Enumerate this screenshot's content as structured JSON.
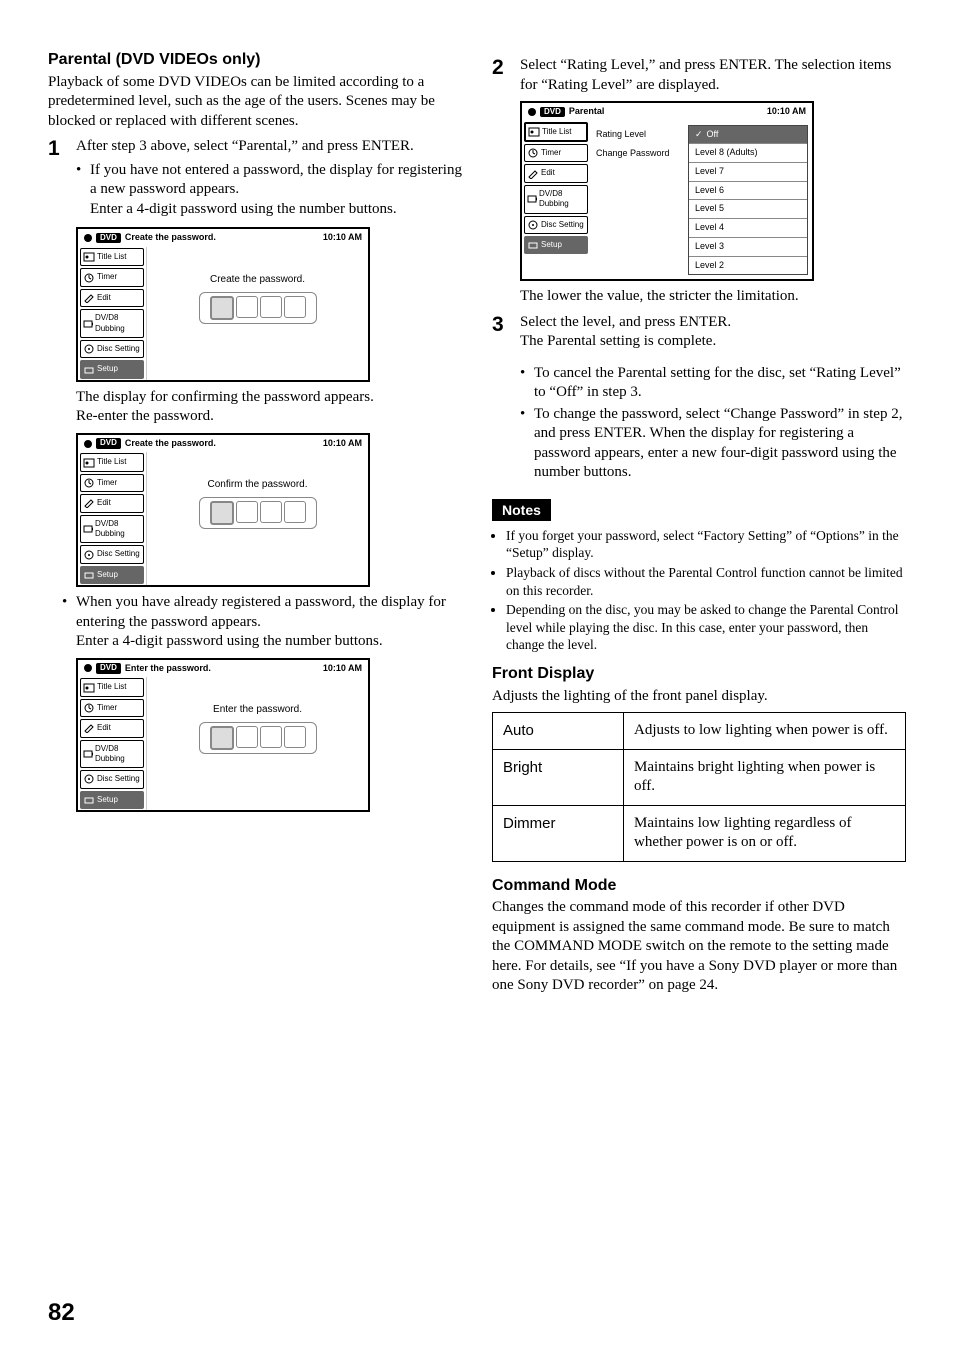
{
  "page_number": "82",
  "left": {
    "heading": "Parental (DVD VIDEOs only)",
    "intro": "Playback of some DVD VIDEOs can be limited according to a predetermined level, such as the age of the users. Scenes may be blocked or replaced with different scenes.",
    "step1": {
      "num": "1",
      "text": "After step 3 above, select “Parental,” and press ENTER.",
      "bullet": "If you have not entered a password, the display for registering a new password appears.",
      "bullet_cont": "Enter a 4-digit password using the number buttons."
    },
    "shot_common": {
      "dvd_badge": "DVD",
      "time": "10:10 AM",
      "menu": {
        "title_list": "Title List",
        "timer": "Timer",
        "edit": "Edit",
        "dv": "DV/D8 Dubbing",
        "disc_setting": "Disc Setting",
        "setup": "Setup"
      }
    },
    "shot1": {
      "title": "Create the password.",
      "prompt": "Create the password."
    },
    "after_shot1_a": "The display for confirming the password appears.",
    "after_shot1_b": "Re-enter the password.",
    "shot2": {
      "title": "Create the password.",
      "prompt": "Confirm the password."
    },
    "bullet2": "When you have already registered a password, the display for entering the password appears.",
    "bullet2_cont": "Enter a 4-digit password using the number buttons.",
    "shot3": {
      "title": "Enter the password.",
      "prompt": "Enter the password."
    }
  },
  "right": {
    "step2": {
      "num": "2",
      "text": "Select “Rating Level,” and press ENTER. The selection items for “Rating Level” are displayed."
    },
    "shot4": {
      "title": "Parental",
      "left_items": {
        "rating": "Rating Level",
        "change": "Change Password"
      },
      "levels": {
        "off": "Off",
        "l8": "Level 8 (Adults)",
        "l7": "Level 7",
        "l6": "Level 6",
        "l5": "Level 5",
        "l4": "Level 4",
        "l3": "Level 3",
        "l2": "Level 2"
      }
    },
    "after_shot4": "The lower the value, the stricter the limitation.",
    "step3": {
      "num": "3",
      "line1": "Select the level, and press ENTER.",
      "line2": "The Parental setting is complete.",
      "bullet1": "To cancel the Parental setting for the disc, set “Rating Level” to “Off” in step 3.",
      "bullet2": "To change the password, select “Change Password” in step 2, and press ENTER. When the display for registering a password appears, enter a new four-digit password using the number buttons."
    },
    "notes_label": "Notes",
    "notes": {
      "n1": "If you forget your password, select “Factory Setting” of “Options” in the “Setup” display.",
      "n2": "Playback of discs without the Parental Control function cannot be limited on this recorder.",
      "n3": "Depending on the disc, you may be asked to change the Parental Control level while playing the disc. In this case, enter your password, then change the level."
    },
    "front_display": {
      "heading": "Front Display",
      "intro": "Adjusts the lighting of the front panel display.",
      "rows": {
        "auto_k": "Auto",
        "auto_v": "Adjusts to low lighting when power is off.",
        "bright_k": "Bright",
        "bright_v": "Maintains bright lighting when power is off.",
        "dimmer_k": "Dimmer",
        "dimmer_v": "Maintains low lighting regardless of whether power is on or off."
      }
    },
    "command_mode": {
      "heading": "Command Mode",
      "body": "Changes the command mode of this recorder if other DVD equipment is assigned the same command mode. Be sure to match the COMMAND MODE switch on the remote to the setting made here. For details, see “If you have a Sony DVD player or more than one Sony DVD recorder” on page 24."
    }
  }
}
